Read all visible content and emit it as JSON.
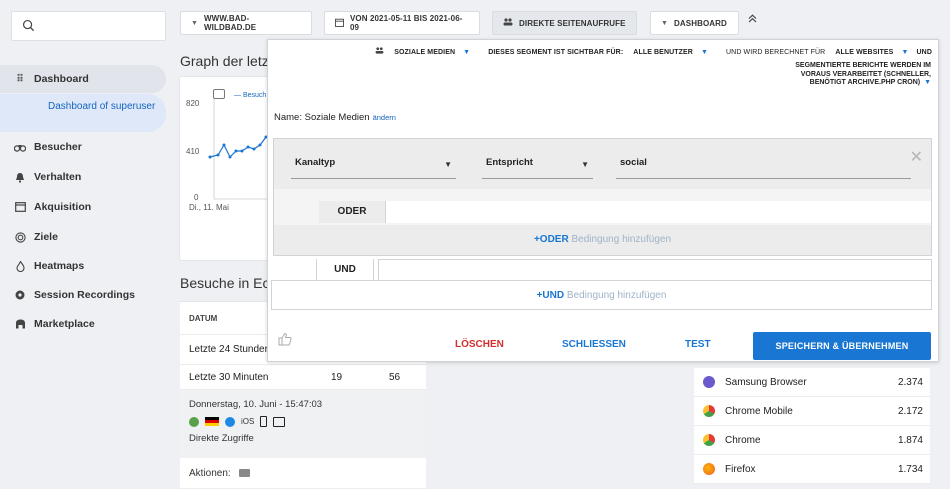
{
  "sidebar": {
    "items": [
      {
        "label": "Dashboard",
        "icon": "grid-icon"
      },
      {
        "label": "Besucher",
        "icon": "binoculars-icon"
      },
      {
        "label": "Verhalten",
        "icon": "bell-icon"
      },
      {
        "label": "Akquisition",
        "icon": "window-icon"
      },
      {
        "label": "Ziele",
        "icon": "target-icon"
      },
      {
        "label": "Heatmaps",
        "icon": "flame-icon"
      },
      {
        "label": "Session Recordings",
        "icon": "record-icon"
      },
      {
        "label": "Marketplace",
        "icon": "store-icon"
      }
    ],
    "sub_item": "Dashboard of superuser"
  },
  "topbar": {
    "site": "WWW.BAD-WILDBAD.DE",
    "period": "VON 2021-05-11 BIS 2021-06-09",
    "segment": "DIREKTE SEITENAUFRUFE",
    "dashboard": "DASHBOARD"
  },
  "background": {
    "graph_title": "Graph der letzt",
    "y_labels": [
      "820",
      "410",
      "0"
    ],
    "x_label": "Di., 11. Mai",
    "legend": "Besuch",
    "visits_title": "Besuche in Ec",
    "table": {
      "header": "DATUM",
      "rows": [
        {
          "label": "Letzte 24 Stunder",
          "a": "",
          "b": ""
        },
        {
          "label": "Letzte 30 Minuten",
          "a": "19",
          "b": "56"
        }
      ],
      "detail_date": "Donnerstag, 10. Juni - 15:47:03",
      "detail_os": "iOS",
      "detail_source": "Direkte Zugriffe",
      "actions": "Aktionen:"
    },
    "browsers": [
      {
        "name": "Samsung Browser",
        "value": "2.374",
        "color": "#6a5acd"
      },
      {
        "name": "Chrome Mobile",
        "value": "2.172",
        "color": "#e9a23b"
      },
      {
        "name": "Chrome",
        "value": "1.874",
        "color": "#e9a23b"
      },
      {
        "name": "Firefox",
        "value": "1.734",
        "color": "#e8622c"
      }
    ]
  },
  "segment_editor": {
    "segment_name": "SOZIALE MEDIEN",
    "visible_label": "DIESES SEGMENT IST SICHTBAR FÜR:",
    "visible_value": "ALLE BENUTZER",
    "processed_label": "UND WIRD BERECHNET FÜR",
    "processed_value": "ALLE WEBSITES",
    "processed_suffix": "UND",
    "note": "SEGMENTIERTE BERICHTE WERDEN IM VORAUS VERARBEITET (SCHNELLER, BENÖTIGT ARCHIVE.PHP CRON)",
    "name_label": "Name: Soziale Medien",
    "change_link": "ändern",
    "condition": {
      "dimension": "Kanaltyp",
      "operator": "Entspricht",
      "value": "social"
    },
    "or_label": "ODER",
    "add_or_strong": "+ODER",
    "add_or_rest": " Bedingung hinzufügen",
    "and_label": "UND",
    "add_and_strong": "+UND",
    "add_and_rest": " Bedingung hinzufügen",
    "delete_label": "LÖSCHEN",
    "close_label": "SCHLIESSEN",
    "test_label": "TEST",
    "save_label": "SPEICHERN & ÜBERNEHMEN",
    "colors": {
      "accent": "#1976d2",
      "danger": "#d32f2f"
    }
  }
}
